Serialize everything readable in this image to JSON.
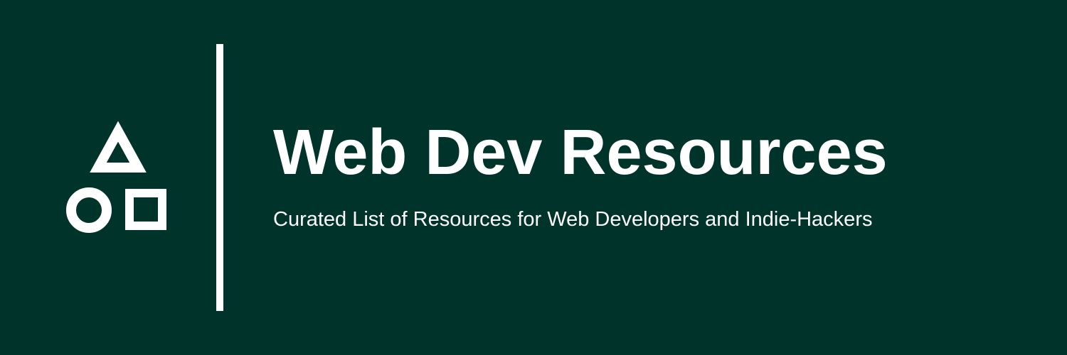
{
  "banner": {
    "title": "Web Dev Resources",
    "subtitle": "Curated List of Resources for Web Developers and Indie-Hackers"
  },
  "logo": {
    "shapes": [
      "triangle-icon",
      "circle-icon",
      "square-icon"
    ]
  },
  "colors": {
    "background": "#003329",
    "foreground": "#ffffff"
  }
}
